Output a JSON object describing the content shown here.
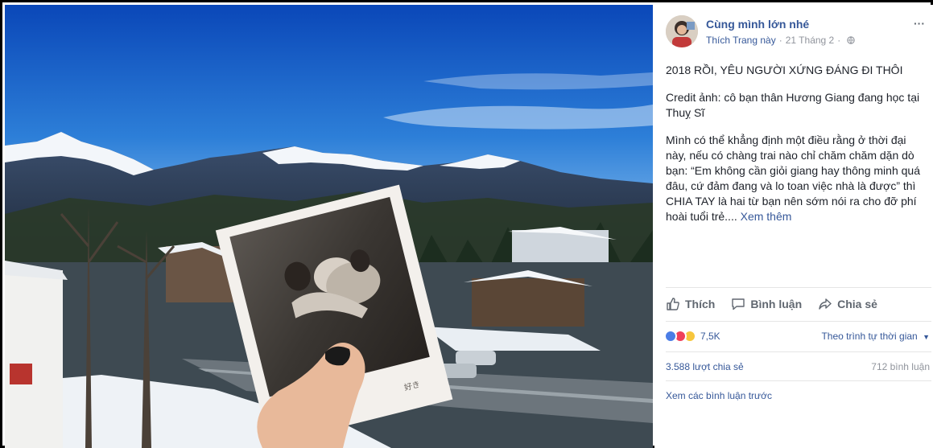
{
  "post": {
    "page_name": "Cùng mình lớn nhé",
    "like_page": "Thích Trang này",
    "separator_dot": "·",
    "date": "21 Tháng 2",
    "more": "···",
    "paragraphs": [
      "2018 RỒI, YÊU NGƯỜI XỨNG ĐÁNG ĐI THÔI",
      "Credit ảnh: cô bạn thân Hương Giang đang học tại Thuỵ Sĩ",
      "Mình có thể khẳng định một điều rằng ở thời đại này, nếu có chàng trai nào chỉ chăm chăm dặn dò bạn: “Em không cần giỏi giang hay thông minh quá đâu, cứ đảm đang và lo toan việc nhà là được” thì CHIA TAY là hai từ bạn nên sớm nói ra cho đỡ phí hoài tuổi trẻ...."
    ],
    "see_more": " Xem thêm"
  },
  "actions": {
    "like": "Thích",
    "comment": "Bình luận",
    "share": "Chia sẻ"
  },
  "stats": {
    "reactions_count": "7,5K",
    "sort_label": "Theo trình tự thời gian",
    "shares": "3.588 lượt chia sẻ",
    "comments": "712 bình luận",
    "previous_comments": "Xem các bình luận trước"
  },
  "photo": {
    "polaroid_caption": "好き"
  },
  "icons": {
    "like": "thumbs-up-icon",
    "comment": "comment-bubble-icon",
    "share": "share-arrow-icon",
    "privacy": "globe-icon",
    "sort": "caret-down-icon"
  },
  "colors": {
    "link": "#365899",
    "muted": "#90949c",
    "text": "#1d2129",
    "like_reaction": "#4b7de6",
    "love_reaction": "#f0405a",
    "haha_reaction": "#f7c63c"
  }
}
